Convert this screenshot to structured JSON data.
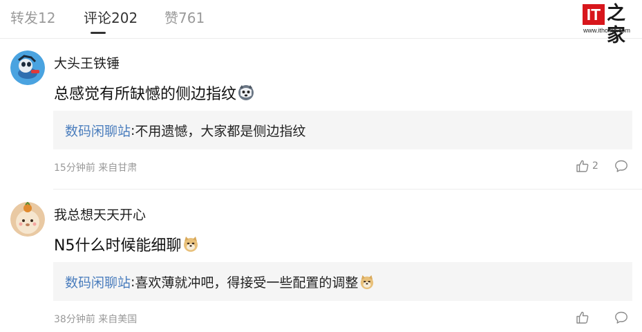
{
  "tabs": [
    {
      "label": "转发12"
    },
    {
      "label": "评论202"
    },
    {
      "label": "赞761"
    }
  ],
  "active_tab": "评论202",
  "logo": {
    "mark": "IT",
    "name": "之家",
    "url": "www.ithome.com"
  },
  "comments": [
    {
      "username": "大头王铁锤",
      "content": "总感觉有所缺憾的侧边指纹",
      "reply": {
        "author": "数码闲聊站",
        "separator": ":",
        "text": "不用遗憾，大家都是侧边指纹"
      },
      "time": "15分钟前",
      "location": "来自甘肃",
      "likes": "2"
    },
    {
      "username": "我总想天天开心",
      "content": "N5什么时候能细聊",
      "reply": {
        "author": "数码闲聊站",
        "separator": ":",
        "text": "喜欢薄就冲吧，得接受一些配置的调整"
      },
      "time": "38分钟前",
      "location": "来自美国",
      "likes": ""
    }
  ],
  "colors": {
    "brand_red": "#d8161c",
    "reply_author": "#4a7dbd",
    "reply_bg": "#f5f5f5"
  }
}
